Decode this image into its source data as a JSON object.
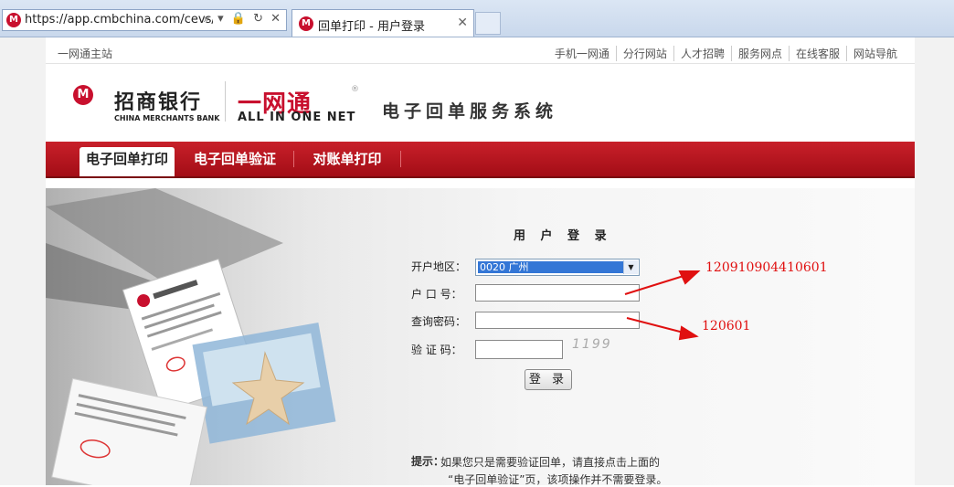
{
  "browser": {
    "url": "https://app.cmbchina.com/cevs/Log",
    "nav_icons": "⌕ ▾ 🔒 ↻ ✕",
    "tab_title": "回单打印 - 用户登录",
    "tab_close": "✕",
    "favicon": "M"
  },
  "top_links": {
    "main_site": "一网通主站",
    "links": [
      "手机一网通",
      "分行网站",
      "人才招聘",
      "服务网点",
      "在线客服",
      "网站导航"
    ]
  },
  "header": {
    "bank_logo_glyph": "M",
    "bank_name": "招商银行",
    "bank_name_en": "CHINA MERCHANTS BANK",
    "brand_name": "一网通",
    "brand_reg": "®",
    "brand_en": "ALL IN ONE NET",
    "system_title": "电子回单服务系统"
  },
  "nav": {
    "tabs": [
      "电子回单打印",
      "电子回单验证",
      "对账单打印"
    ],
    "active_index": 0
  },
  "login": {
    "title": "用 户 登 录",
    "region_label": "开户地区：",
    "region_value": "0020 广州",
    "account_label": "户 口 号：",
    "password_label": "查询密码：",
    "captcha_label": "验 证 码：",
    "captcha_text": "1199",
    "submit_label": "登 录"
  },
  "tip": {
    "label": "提示：",
    "line1": "如果您只是需要验证回单，请直接点击上面的",
    "line2": "“电子回单验证”页，该项操作并不需要登录。"
  },
  "annotations": {
    "account_hint": "120910904410601",
    "password_hint": "120601"
  },
  "colors": {
    "brand_red": "#c8102e",
    "nav_red": "#b0121c",
    "selection_blue": "#3376d6",
    "annotation_red": "#e01010"
  }
}
